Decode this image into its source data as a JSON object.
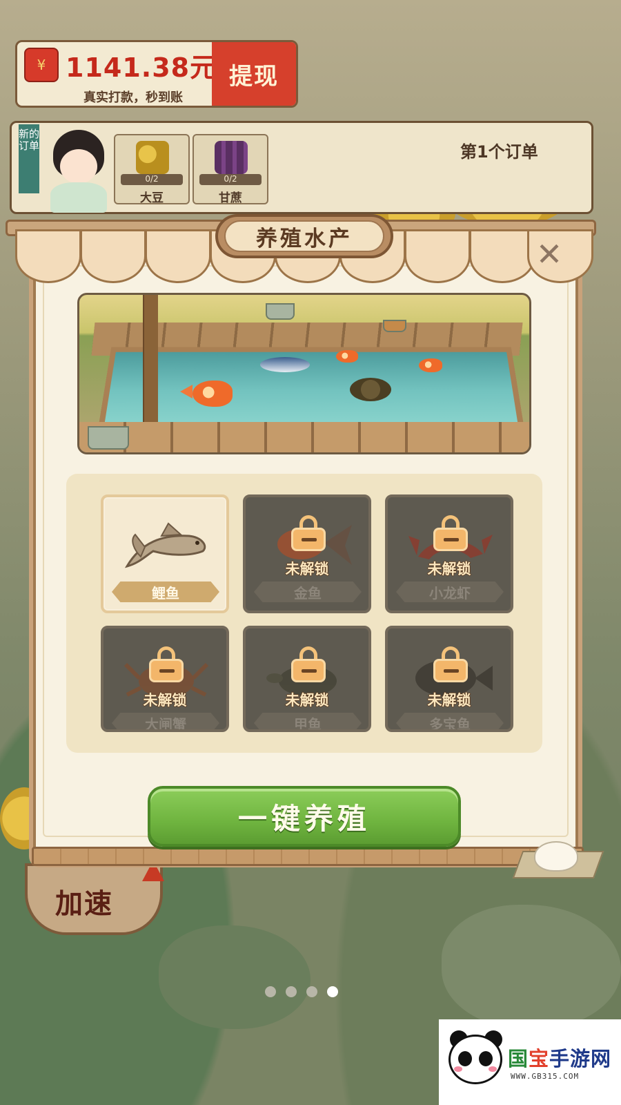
{
  "wallet": {
    "amount": "1141.38元",
    "subtitle": "真实打款，秒到账",
    "withdraw_label": "提现",
    "icon": "red-envelope-icon"
  },
  "order": {
    "tag": "新的订单",
    "title": "第1个订单",
    "items": [
      {
        "name": "大豆",
        "progress": "0/2",
        "icon": "soybean-icon"
      },
      {
        "name": "甘蔗",
        "progress": "0/2",
        "icon": "sugarcane-icon"
      }
    ]
  },
  "modal": {
    "title": "养殖水产",
    "close_icon": "close-icon",
    "breed_button": "一键养殖",
    "species": [
      {
        "name": "鲤鱼",
        "locked": false,
        "icon": "carp-icon"
      },
      {
        "name": "金鱼",
        "locked": true,
        "locked_label": "未解锁",
        "icon": "goldfish-icon"
      },
      {
        "name": "小龙虾",
        "locked": true,
        "locked_label": "未解锁",
        "icon": "crayfish-icon"
      },
      {
        "name": "大闸蟹",
        "locked": true,
        "locked_label": "未解锁",
        "icon": "crab-icon"
      },
      {
        "name": "甲鱼",
        "locked": true,
        "locked_label": "未解锁",
        "icon": "softshell-turtle-icon"
      },
      {
        "name": "多宝鱼",
        "locked": true,
        "locked_label": "未解锁",
        "icon": "turbot-icon"
      }
    ]
  },
  "speed_badge": {
    "label": "加速"
  },
  "pager": {
    "count": 4,
    "active_index": 3
  },
  "watermark": {
    "brand_1": "国",
    "brand_2": "宝",
    "brand_3": "手游网",
    "url": "WWW.GB315.COM"
  },
  "colors": {
    "accent_red": "#d6402c",
    "button_green": "#6fb43f",
    "panel_cream": "#f8f2e2",
    "wood_brown": "#a07a50"
  }
}
